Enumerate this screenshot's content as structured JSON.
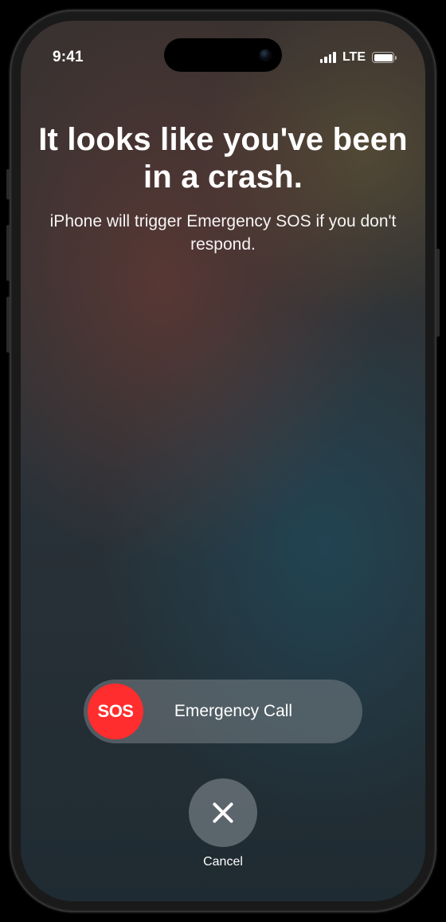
{
  "status_bar": {
    "time": "9:41",
    "network_label": "LTE"
  },
  "alert": {
    "headline": "It looks like you've been in a crash.",
    "subhead": "iPhone will trigger Emergency SOS if you don't respond."
  },
  "slider": {
    "knob_text": "SOS",
    "label": "Emergency Call"
  },
  "cancel": {
    "label": "Cancel"
  },
  "colors": {
    "sos_red": "#ff2d2d"
  }
}
